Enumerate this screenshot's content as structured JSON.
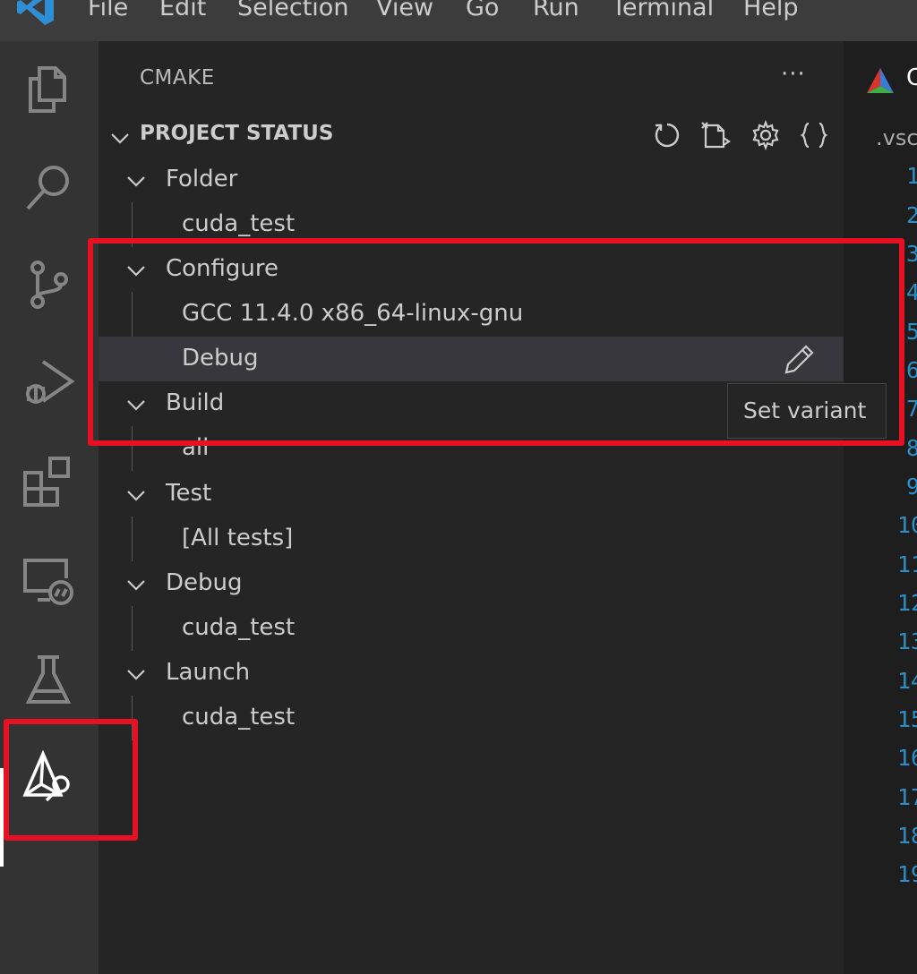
{
  "menu": {
    "items": [
      "File",
      "Edit",
      "Selection",
      "View",
      "Go",
      "Run",
      "Terminal",
      "Help"
    ]
  },
  "activity_bar": {
    "icons": [
      "explorer-icon",
      "search-icon",
      "source-control-icon",
      "run-debug-icon",
      "extensions-icon",
      "remote-explorer-icon",
      "testing-icon",
      "cmake-icon"
    ],
    "active": "cmake-icon"
  },
  "sidebar": {
    "title": "CMAKE",
    "more": "···",
    "section": {
      "title": "PROJECT STATUS",
      "toolbar_icons": [
        "refresh-icon",
        "new-file-icon",
        "settings-gear-icon",
        "braces-icon"
      ]
    },
    "groups": {
      "folder": {
        "label": "Folder",
        "child": "cuda_test"
      },
      "configure": {
        "label": "Configure",
        "kit": "GCC 11.4.0 x86_64-linux-gnu",
        "variant": "Debug"
      },
      "build": {
        "label": "Build",
        "child": "all"
      },
      "test": {
        "label": "Test",
        "child": "[All tests]"
      },
      "debug": {
        "label": "Debug",
        "child": "cuda_test"
      },
      "launch": {
        "label": "Launch",
        "child": "cuda_test"
      }
    },
    "tooltip": "Set variant"
  },
  "editor": {
    "tab_label": "C",
    "breadcrumb": ".vsc",
    "line_numbers": [
      "1",
      "2",
      "3",
      "4",
      "5",
      "6",
      "7",
      "8",
      "9",
      "10",
      "11",
      "12",
      "13",
      "14",
      "15",
      "16",
      "17",
      "18",
      "19"
    ]
  },
  "colors": {
    "highlight": "#e81123",
    "line_number": "#2b8fc7",
    "sidebar_bg": "#252526",
    "activity_bg": "#333333"
  }
}
